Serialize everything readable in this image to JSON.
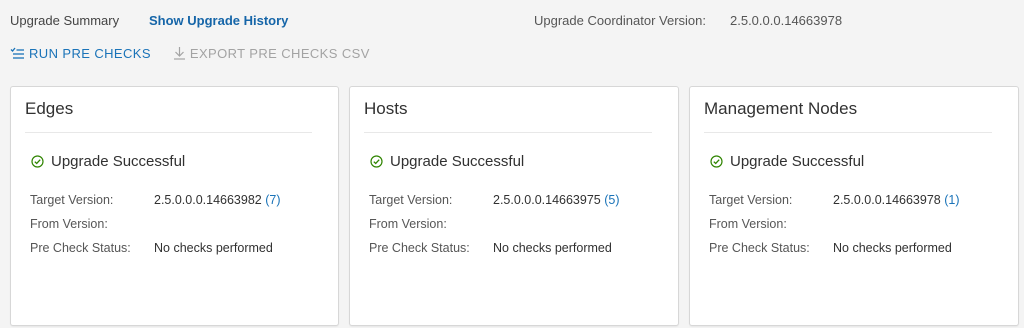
{
  "header": {
    "title": "Upgrade Summary",
    "history_link": "Show Upgrade History",
    "coordinator_label": "Upgrade Coordinator Version:",
    "coordinator_version": "2.5.0.0.0.14663978"
  },
  "toolbar": {
    "run_label": "RUN PRE CHECKS",
    "export_label": "EXPORT PRE CHECKS CSV"
  },
  "labels": {
    "target_version": "Target Version:",
    "from_version": "From Version:",
    "pre_check_status": "Pre Check Status:"
  },
  "cards": [
    {
      "title": "Edges",
      "status": "Upgrade Successful",
      "target_version": "2.5.0.0.0.14663982",
      "count": "(7)",
      "from_version": "",
      "pre_check_status": "No checks performed"
    },
    {
      "title": "Hosts",
      "status": "Upgrade Successful",
      "target_version": "2.5.0.0.0.14663975",
      "count": "(5)",
      "from_version": "",
      "pre_check_status": "No checks performed"
    },
    {
      "title": "Management Nodes",
      "status": "Upgrade Successful",
      "target_version": "2.5.0.0.0.14663978",
      "count": "(1)",
      "from_version": "",
      "pre_check_status": "No checks performed"
    }
  ],
  "colors": {
    "link": "#1565a8",
    "success": "#2f8400",
    "disabled": "#a3a3a3"
  },
  "icons": {
    "run": "run-checks-icon",
    "export": "download-icon",
    "status": "check-circle-icon"
  }
}
